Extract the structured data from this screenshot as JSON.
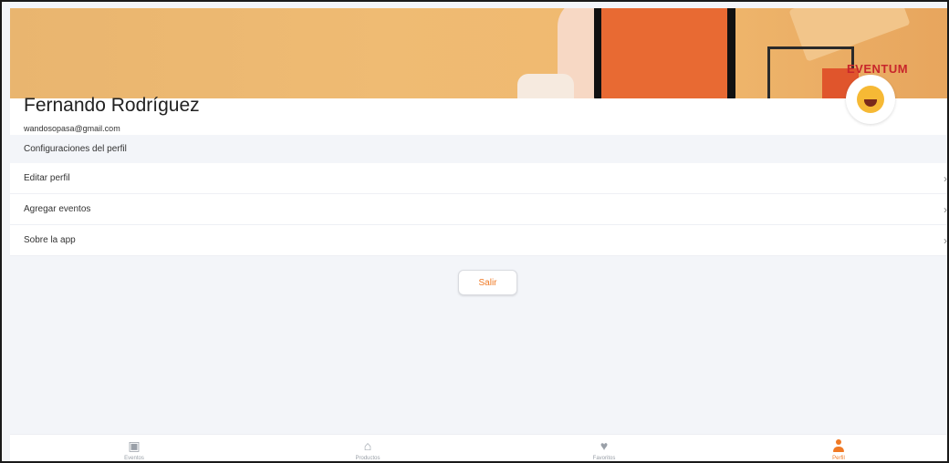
{
  "profile": {
    "name": "Fernando Rodríguez",
    "email": "wandosopasa@gmail.com",
    "brand_text": "EVENTUM"
  },
  "settings": {
    "section_title": "Configuraciones del perfil",
    "items": [
      {
        "label": "Editar perfil"
      },
      {
        "label": "Agregar eventos"
      },
      {
        "label": "Sobre la app"
      }
    ],
    "chevron": "›"
  },
  "actions": {
    "logout_label": "Salir"
  },
  "tabbar": {
    "tabs": [
      {
        "label": "Eventos",
        "icon": "calendar-icon"
      },
      {
        "label": "Productos",
        "icon": "basket-icon"
      },
      {
        "label": "Favoritos",
        "icon": "heart-icon"
      },
      {
        "label": "Perfil",
        "icon": "person-icon"
      }
    ],
    "active_index": 3
  },
  "colors": {
    "accent": "#f07a26",
    "background": "#f3f5f9",
    "inactive": "#9aa0a8"
  }
}
